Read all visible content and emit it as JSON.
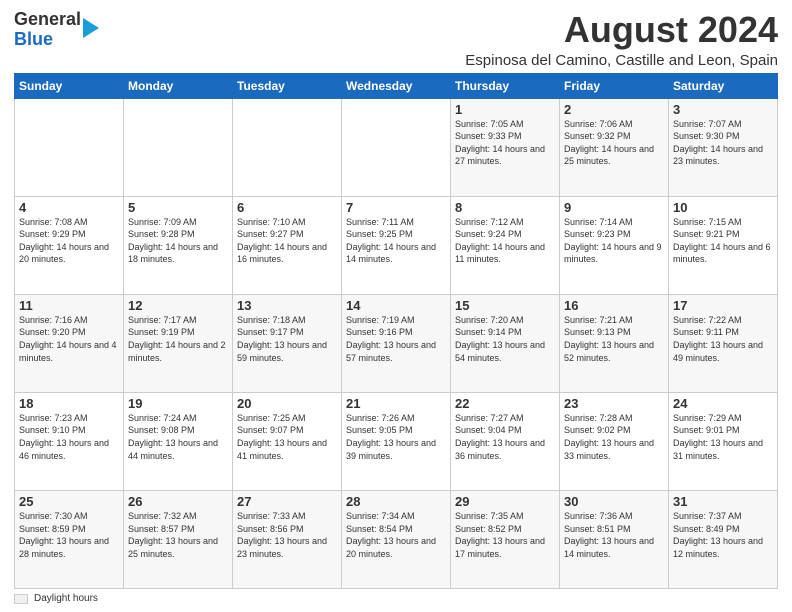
{
  "header": {
    "logo_line1": "General",
    "logo_line2": "Blue",
    "main_title": "August 2024",
    "subtitle": "Espinosa del Camino, Castille and Leon, Spain"
  },
  "calendar": {
    "days_of_week": [
      "Sunday",
      "Monday",
      "Tuesday",
      "Wednesday",
      "Thursday",
      "Friday",
      "Saturday"
    ],
    "weeks": [
      [
        {
          "day": "",
          "info": ""
        },
        {
          "day": "",
          "info": ""
        },
        {
          "day": "",
          "info": ""
        },
        {
          "day": "",
          "info": ""
        },
        {
          "day": "1",
          "info": "Sunrise: 7:05 AM\nSunset: 9:33 PM\nDaylight: 14 hours and 27 minutes."
        },
        {
          "day": "2",
          "info": "Sunrise: 7:06 AM\nSunset: 9:32 PM\nDaylight: 14 hours and 25 minutes."
        },
        {
          "day": "3",
          "info": "Sunrise: 7:07 AM\nSunset: 9:30 PM\nDaylight: 14 hours and 23 minutes."
        }
      ],
      [
        {
          "day": "4",
          "info": "Sunrise: 7:08 AM\nSunset: 9:29 PM\nDaylight: 14 hours and 20 minutes."
        },
        {
          "day": "5",
          "info": "Sunrise: 7:09 AM\nSunset: 9:28 PM\nDaylight: 14 hours and 18 minutes."
        },
        {
          "day": "6",
          "info": "Sunrise: 7:10 AM\nSunset: 9:27 PM\nDaylight: 14 hours and 16 minutes."
        },
        {
          "day": "7",
          "info": "Sunrise: 7:11 AM\nSunset: 9:25 PM\nDaylight: 14 hours and 14 minutes."
        },
        {
          "day": "8",
          "info": "Sunrise: 7:12 AM\nSunset: 9:24 PM\nDaylight: 14 hours and 11 minutes."
        },
        {
          "day": "9",
          "info": "Sunrise: 7:14 AM\nSunset: 9:23 PM\nDaylight: 14 hours and 9 minutes."
        },
        {
          "day": "10",
          "info": "Sunrise: 7:15 AM\nSunset: 9:21 PM\nDaylight: 14 hours and 6 minutes."
        }
      ],
      [
        {
          "day": "11",
          "info": "Sunrise: 7:16 AM\nSunset: 9:20 PM\nDaylight: 14 hours and 4 minutes."
        },
        {
          "day": "12",
          "info": "Sunrise: 7:17 AM\nSunset: 9:19 PM\nDaylight: 14 hours and 2 minutes."
        },
        {
          "day": "13",
          "info": "Sunrise: 7:18 AM\nSunset: 9:17 PM\nDaylight: 13 hours and 59 minutes."
        },
        {
          "day": "14",
          "info": "Sunrise: 7:19 AM\nSunset: 9:16 PM\nDaylight: 13 hours and 57 minutes."
        },
        {
          "day": "15",
          "info": "Sunrise: 7:20 AM\nSunset: 9:14 PM\nDaylight: 13 hours and 54 minutes."
        },
        {
          "day": "16",
          "info": "Sunrise: 7:21 AM\nSunset: 9:13 PM\nDaylight: 13 hours and 52 minutes."
        },
        {
          "day": "17",
          "info": "Sunrise: 7:22 AM\nSunset: 9:11 PM\nDaylight: 13 hours and 49 minutes."
        }
      ],
      [
        {
          "day": "18",
          "info": "Sunrise: 7:23 AM\nSunset: 9:10 PM\nDaylight: 13 hours and 46 minutes."
        },
        {
          "day": "19",
          "info": "Sunrise: 7:24 AM\nSunset: 9:08 PM\nDaylight: 13 hours and 44 minutes."
        },
        {
          "day": "20",
          "info": "Sunrise: 7:25 AM\nSunset: 9:07 PM\nDaylight: 13 hours and 41 minutes."
        },
        {
          "day": "21",
          "info": "Sunrise: 7:26 AM\nSunset: 9:05 PM\nDaylight: 13 hours and 39 minutes."
        },
        {
          "day": "22",
          "info": "Sunrise: 7:27 AM\nSunset: 9:04 PM\nDaylight: 13 hours and 36 minutes."
        },
        {
          "day": "23",
          "info": "Sunrise: 7:28 AM\nSunset: 9:02 PM\nDaylight: 13 hours and 33 minutes."
        },
        {
          "day": "24",
          "info": "Sunrise: 7:29 AM\nSunset: 9:01 PM\nDaylight: 13 hours and 31 minutes."
        }
      ],
      [
        {
          "day": "25",
          "info": "Sunrise: 7:30 AM\nSunset: 8:59 PM\nDaylight: 13 hours and 28 minutes."
        },
        {
          "day": "26",
          "info": "Sunrise: 7:32 AM\nSunset: 8:57 PM\nDaylight: 13 hours and 25 minutes."
        },
        {
          "day": "27",
          "info": "Sunrise: 7:33 AM\nSunset: 8:56 PM\nDaylight: 13 hours and 23 minutes."
        },
        {
          "day": "28",
          "info": "Sunrise: 7:34 AM\nSunset: 8:54 PM\nDaylight: 13 hours and 20 minutes."
        },
        {
          "day": "29",
          "info": "Sunrise: 7:35 AM\nSunset: 8:52 PM\nDaylight: 13 hours and 17 minutes."
        },
        {
          "day": "30",
          "info": "Sunrise: 7:36 AM\nSunset: 8:51 PM\nDaylight: 13 hours and 14 minutes."
        },
        {
          "day": "31",
          "info": "Sunrise: 7:37 AM\nSunset: 8:49 PM\nDaylight: 13 hours and 12 minutes."
        }
      ]
    ]
  },
  "footer": {
    "legend_label": "Daylight hours"
  }
}
